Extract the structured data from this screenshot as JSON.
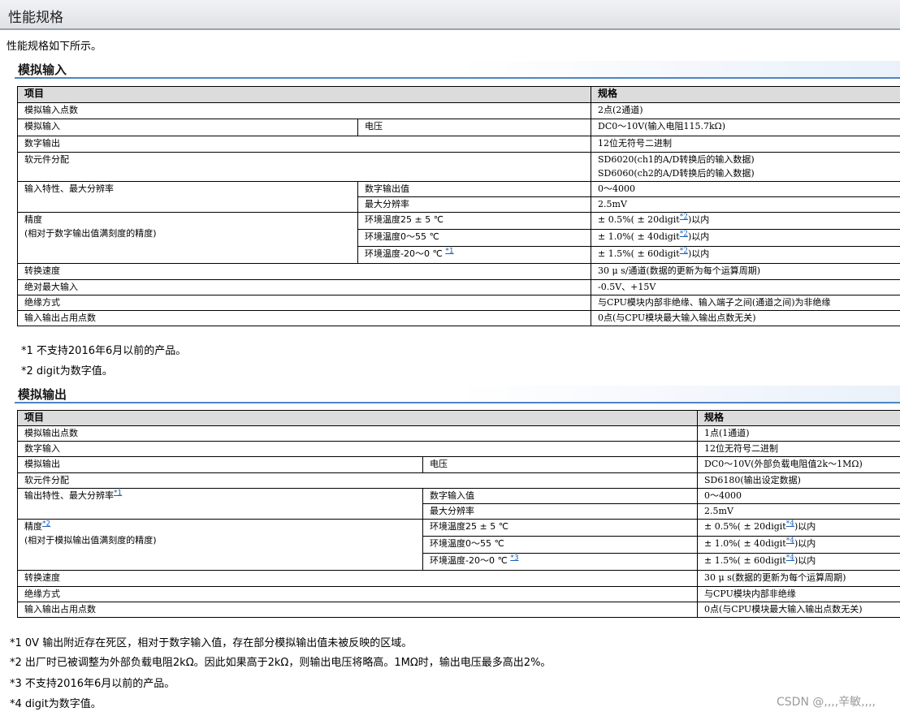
{
  "page_title": "性能规格",
  "intro": "性能规格如下所示。",
  "analog_input": {
    "heading": "模拟输入",
    "col_item": "项目",
    "col_spec": "规格",
    "rows": {
      "points_label": "模拟输入点数",
      "points_value": "2点(2通道)",
      "ain_label": "模拟输入",
      "ain_sub": "电压",
      "ain_value": "DC0～10V(输入电阻115.7kΩ)",
      "dout_label": "数字输出",
      "dout_value": "12位无符号二进制",
      "dev_label": "软元件分配",
      "dev_value1": "SD6020(ch1的A/D转换后的输入数据)",
      "dev_value2": "SD6060(ch2的A/D转换后的输入数据)",
      "char_label": "输入特性、最大分辨率",
      "char_sub1": "数字输出值",
      "char_value1": "0～4000",
      "char_sub2": "最大分辨率",
      "char_value2": "2.5mV",
      "acc_label1": "精度",
      "acc_label2": "(相对于数字输出值满刻度的精度)",
      "acc_sub1": "环境温度25 ± 5 ℃",
      "acc_value1_pre": " ± 0.5%( ± 20digit",
      "acc_value1_fn": "*2",
      "acc_value1_post": ")以内",
      "acc_sub2": "环境温度0～55 ℃",
      "acc_value2_pre": " ± 1.0%( ± 40digit",
      "acc_value2_fn": "*2",
      "acc_value2_post": ")以内",
      "acc_sub3": "环境温度-20～0 ℃ ",
      "acc_sub3_fn": "*1",
      "acc_value3_pre": " ± 1.5%( ± 60digit",
      "acc_value3_fn": "*2",
      "acc_value3_post": ")以内",
      "speed_label": "转换速度",
      "speed_value": "30 μ s/通道(数据的更新为每个运算周期)",
      "absmax_label": "绝对最大输入",
      "absmax_value": "-0.5V、+15V",
      "iso_label": "绝缘方式",
      "iso_value": "与CPU模块内部非绝缘、输入端子之间(通道之间)为非绝缘",
      "io_label": "输入输出占用点数",
      "io_value": "0点(与CPU模块最大输入输出点数无关)"
    },
    "notes": [
      "*1 不支持2016年6月以前的产品。",
      "*2 digit为数字值。"
    ]
  },
  "analog_output": {
    "heading": "模拟输出",
    "col_item": "项目",
    "col_spec": "规格",
    "rows": {
      "points_label": "模拟输出点数",
      "points_value": "1点(1通道)",
      "din_label": "数字输入",
      "din_value": "12位无符号二进制",
      "aout_label": "模拟输出",
      "aout_sub": "电压",
      "aout_value": "DC0～10V(外部负载电阻值2k～1MΩ)",
      "dev_label": "软元件分配",
      "dev_value": "SD6180(输出设定数据)",
      "char_label": "输出特性、最大分辨率",
      "char_label_fn": "*1",
      "char_sub1": "数字输入值",
      "char_value1": "0～4000",
      "char_sub2": "最大分辨率",
      "char_value2": "2.5mV",
      "acc_label1": "精度",
      "acc_label1_fn": "*2",
      "acc_label2": "(相对于模拟输出值满刻度的精度)",
      "acc_sub1": "环境温度25 ± 5 ℃",
      "acc_value1_pre": " ± 0.5%( ± 20digit",
      "acc_value1_fn": "*4",
      "acc_value1_post": ")以内",
      "acc_sub2": "环境温度0～55 ℃",
      "acc_value2_pre": " ± 1.0%( ± 40digit",
      "acc_value2_fn": "*4",
      "acc_value2_post": ")以内",
      "acc_sub3": "环境温度-20～0 ℃ ",
      "acc_sub3_fn": "*3",
      "acc_value3_pre": " ± 1.5%( ± 60digit",
      "acc_value3_fn": "*4",
      "acc_value3_post": ")以内",
      "speed_label": "转换速度",
      "speed_value": "30 μ s(数据的更新为每个运算周期)",
      "iso_label": "绝缘方式",
      "iso_value": "与CPU模块内部非绝缘",
      "io_label": "输入输出占用点数",
      "io_value": "0点(与CPU模块最大输入输出点数无关)"
    },
    "notes": [
      "*1 0V 输出附近存在死区，相对于数字输入值，存在部分模拟输出值未被反映的区域。",
      "*2 出厂时已被调整为外部负载电阻2kΩ。因此如果高于2kΩ，则输出电压将略高。1MΩ时，输出电压最多高出2%。",
      "*3 不支持2016年6月以前的产品。",
      "*4 digit为数字值。"
    ]
  },
  "watermark": "CSDN @,,,,辛敏,,,,"
}
